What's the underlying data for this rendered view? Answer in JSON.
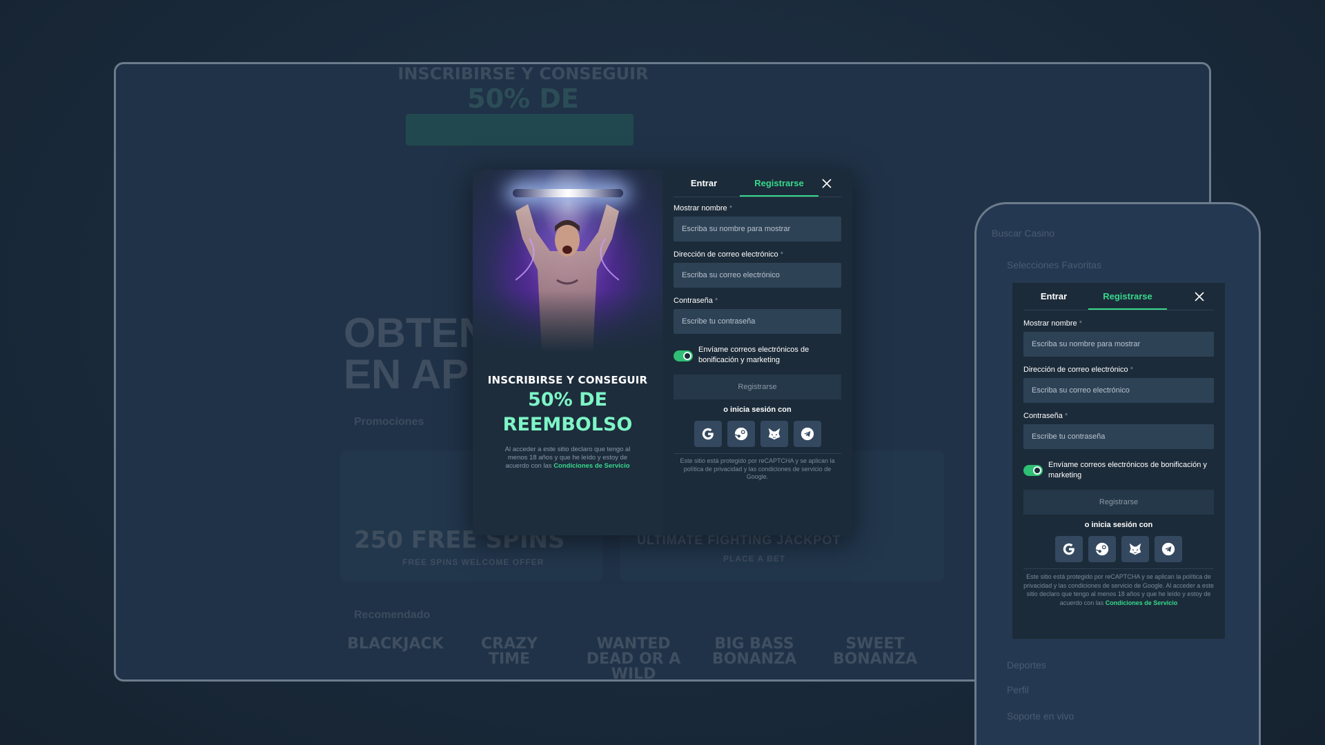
{
  "background": {
    "hero_line1": "INSCRIBIRSE Y CONSEGUIR",
    "hero_line2": "50% DE REEMBOLSO",
    "side_text": "OBTEN EN AP",
    "section_promos": "Promociones",
    "section_recommended": "Recomendado",
    "promo_card_title": "250 FREE SPINS",
    "promo_card_sub": "FREE SPINS WELCOME OFFER",
    "promo_card2_title": "ULTIMATE FIGHTING JACKPOT",
    "promo_card2_sub": "PLACE A BET",
    "games": [
      "BLACKJACK",
      "CRAZY TIME",
      "WANTED DEAD OR A WILD",
      "BIG BASS BONANZA",
      "SWEET BONANZA"
    ],
    "phone_items": [
      "Buscar Casino",
      "Selecciones Favoritas",
      "Deportes",
      "Perfil",
      "Soporte en vivo"
    ]
  },
  "promo": {
    "line1": "INSCRIBIRSE Y CONSEGUIR",
    "line2a": "50% DE",
    "line2b": "REEMBOLSO",
    "legal_prefix": "Al acceder a este sitio declaro que tengo al menos 18 años y que he leído y estoy de acuerdo con las",
    "legal_link": "Condiciones de Servicio"
  },
  "form": {
    "tab_login": "Entrar",
    "tab_register": "Registrarse",
    "name_label": "Mostrar nombre",
    "name_placeholder": "Escriba su nombre para mostrar",
    "email_label": "Dirección de correo electrónico",
    "email_placeholder": "Escriba su correo electrónico",
    "password_label": "Contraseña",
    "password_placeholder": "Escribe tu contraseña",
    "required_mark": "*",
    "marketing_label": "Envíame correos electrónicos de bonificación y marketing",
    "marketing_enabled": true,
    "submit_label": "Registrarse",
    "or_label": "o inicia sesión con",
    "social": [
      "google-icon",
      "steam-icon",
      "metamask-icon",
      "telegram-icon"
    ],
    "recaptcha": "Este sitio está protegido por reCAPTCHA y se aplican la política de privacidad y las condiciones de servicio de Google."
  },
  "mobile_form": {
    "recaptcha": "Este sitio está protegido por reCAPTCHA y se aplican la política de privacidad y las condiciones de servicio de Google. Al acceder a este sitio declaro que tengo al menos 18 años y que he leído y estoy de acuerdo con las",
    "recaptcha_link": "Condiciones de Servicio"
  },
  "colors": {
    "accent": "#37d98d",
    "promo_highlight": "#7ef5c6",
    "modal_bg": "#1c2b39",
    "input_bg": "#2e4256"
  }
}
